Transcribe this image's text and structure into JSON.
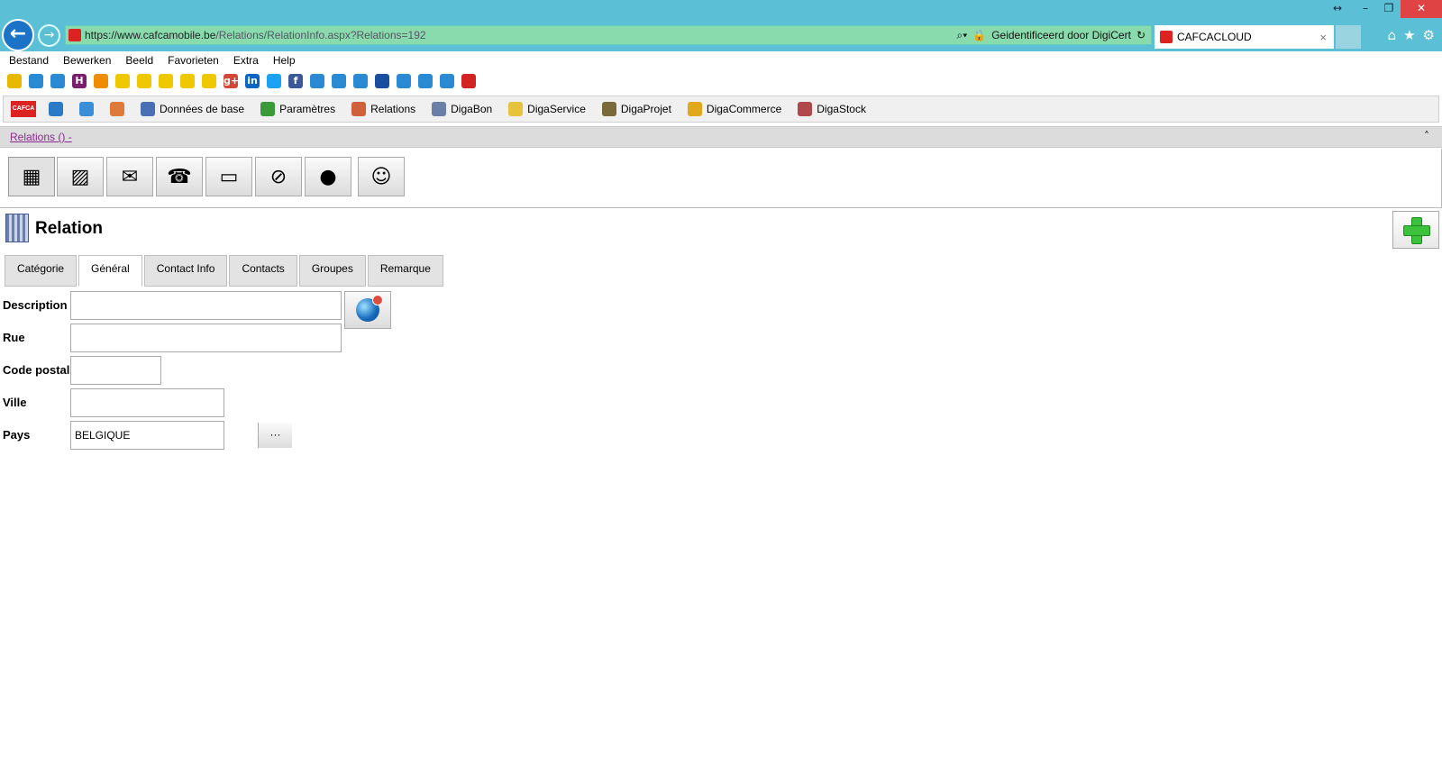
{
  "browser": {
    "url_prefix": "https://www.",
    "url_domain": "cafcamobile.be",
    "url_path": "/Relations/RelationInfo.aspx?Relations=192",
    "identity": "Geidentificeerd door DigiCert",
    "tab_title": "CAFCACLOUD",
    "tab_close": "×",
    "back_glyph": "←",
    "forward_glyph": "→",
    "window_buttons": [
      "↔",
      "–",
      "❐",
      "✕"
    ],
    "toolbar_icons": [
      "home-icon",
      "star-icon",
      "gear-icon"
    ]
  },
  "menu": {
    "items": [
      "Bestand",
      "Bewerken",
      "Beeld",
      "Favorieten",
      "Extra",
      "Help"
    ]
  },
  "favorites": {
    "icons": [
      {
        "name": "add-favorite-icon",
        "color": "#e8b800"
      },
      {
        "name": "ie-link-icon",
        "color": "#2a8ad4"
      },
      {
        "name": "ie-link-icon",
        "color": "#2a8ad4"
      },
      {
        "name": "h-logo-icon",
        "color": "#7a1f6e",
        "glyph": "H"
      },
      {
        "name": "flag-be-icon",
        "color": "#f08c00"
      },
      {
        "name": "radiation-icon",
        "color": "#f0c800"
      },
      {
        "name": "radiation-icon",
        "color": "#f0c800"
      },
      {
        "name": "radiation-icon",
        "color": "#f0c800"
      },
      {
        "name": "radiation-icon",
        "color": "#f0c800"
      },
      {
        "name": "radiation-icon",
        "color": "#f0c800"
      },
      {
        "name": "google-plus-icon",
        "color": "#d34836",
        "glyph": "g+"
      },
      {
        "name": "linkedin-icon",
        "color": "#0a66c2",
        "glyph": "in"
      },
      {
        "name": "twitter-icon",
        "color": "#1da1f2"
      },
      {
        "name": "facebook-icon",
        "color": "#3b5998",
        "glyph": "f"
      },
      {
        "name": "ie-link-icon",
        "color": "#2a8ad4"
      },
      {
        "name": "ie-link-icon",
        "color": "#2a8ad4"
      },
      {
        "name": "ie-link-icon",
        "color": "#2a8ad4"
      },
      {
        "name": "globe-icon",
        "color": "#1a4fa0"
      },
      {
        "name": "ie-link-icon",
        "color": "#2a8ad4"
      },
      {
        "name": "ie-link-icon",
        "color": "#2a8ad4"
      },
      {
        "name": "ie-link-icon",
        "color": "#2a8ad4"
      },
      {
        "name": "cafca-icon",
        "color": "#d22222"
      }
    ]
  },
  "appmenu": {
    "logo": "CAFCA",
    "items": [
      {
        "label": "",
        "icon": "globe-icon",
        "color": "#2a7ac8"
      },
      {
        "label": "",
        "icon": "refresh-icon",
        "color": "#3b8fd8"
      },
      {
        "label": "",
        "icon": "user-icon",
        "color": "#e07a3a"
      },
      {
        "label": "Données de base",
        "icon": "database-icon",
        "color": "#4a6fb5"
      },
      {
        "label": "Paramètres",
        "icon": "settings-icon",
        "color": "#3a9a3a"
      },
      {
        "label": "Relations",
        "icon": "users-icon",
        "color": "#d0603a"
      },
      {
        "label": "DigaBon",
        "icon": "document-icon",
        "color": "#6a7fa8"
      },
      {
        "label": "DigaService",
        "icon": "service-icon",
        "color": "#e6c33a"
      },
      {
        "label": "DigaProjet",
        "icon": "project-icon",
        "color": "#7a6a3a"
      },
      {
        "label": "DigaCommerce",
        "icon": "coin-icon",
        "color": "#e0a81a"
      },
      {
        "label": "DigaStock",
        "icon": "stock-icon",
        "color": "#b04a4a"
      }
    ]
  },
  "relations_bar": {
    "link": "Relations () -",
    "collapse_glyph": "˄"
  },
  "icon_buttons": [
    {
      "name": "building-icon",
      "glyph": "▦"
    },
    {
      "name": "package-icon",
      "glyph": "▨"
    },
    {
      "name": "mail-icon",
      "glyph": "✉"
    },
    {
      "name": "phone-contact-icon",
      "glyph": "☎"
    },
    {
      "name": "folder-icon",
      "glyph": "▭"
    },
    {
      "name": "no-document-icon",
      "glyph": "⊘"
    },
    {
      "name": "globe-icon",
      "glyph": "●"
    },
    {
      "name": "people-icon",
      "glyph": "☺"
    }
  ],
  "page": {
    "title": "Relation"
  },
  "tabs": [
    "Catégorie",
    "Général",
    "Contact Info",
    "Contacts",
    "Groupes",
    "Remarque"
  ],
  "active_tab": "Général",
  "form": {
    "description": {
      "label": "Description",
      "value": ""
    },
    "rue": {
      "label": "Rue",
      "value": ""
    },
    "code_postal": {
      "label": "Code postal",
      "value": ""
    },
    "ville": {
      "label": "Ville",
      "value": ""
    },
    "pays": {
      "label": "Pays",
      "value": "BELGIQUE",
      "button": "···"
    }
  }
}
